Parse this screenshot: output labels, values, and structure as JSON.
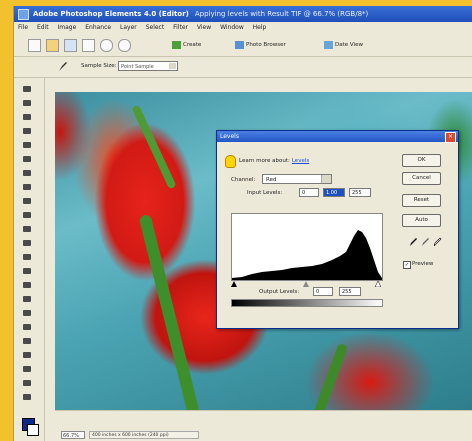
{
  "window": {
    "title": "Adobe Photoshop Elements 4.0 (Editor)",
    "subtitle": "Applying levels with Result TIF @ 66.7% (RGB/8*)"
  },
  "menubar": [
    "File",
    "Edit",
    "Image",
    "Enhance",
    "Layer",
    "Select",
    "Filter",
    "View",
    "Window",
    "Help"
  ],
  "shortcuts": {
    "create_label": "Create",
    "photo_browser_label": "Photo Browser",
    "date_view_label": "Date View"
  },
  "options_bar": {
    "sample_size_label": "Sample Size:",
    "sample_size_value": "Point Sample"
  },
  "levels_dialog": {
    "title": "Levels",
    "learn_text": "Learn more about:",
    "learn_link": "Levels",
    "channel_label": "Channel:",
    "channel_value": "Red",
    "input_levels_label": "Input Levels:",
    "input_values": [
      "0",
      "1.00",
      "255"
    ],
    "output_levels_label": "Output Levels:",
    "output_values": [
      "0",
      "255"
    ],
    "buttons": {
      "ok": "OK",
      "cancel": "Cancel",
      "reset": "Reset",
      "auto": "Auto"
    },
    "preview_label": "Preview",
    "preview_checked": true
  },
  "status": {
    "zoom": "66.7%",
    "info": "400 inches x 600 inches (240 ppi)"
  },
  "colors": {
    "title_bar": "#1f4fb8",
    "foreground_swatch": "#0a2a8c",
    "background_swatch": "#ffffff"
  }
}
